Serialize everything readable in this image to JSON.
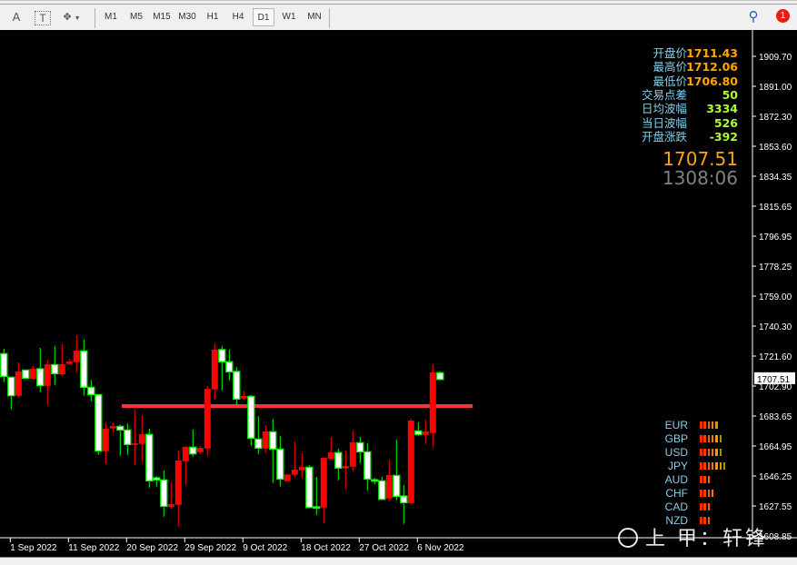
{
  "toolbar": {
    "tools": [
      {
        "name": "text-tool",
        "label": "A"
      },
      {
        "name": "text-label-tool",
        "label": "T"
      },
      {
        "name": "objects-tool",
        "label": "⬩"
      }
    ],
    "timeframes": [
      "M1",
      "M5",
      "M15",
      "M30",
      "H1",
      "H4",
      "D1",
      "W1",
      "MN"
    ],
    "active_timeframe": "D1",
    "notification_count": "1"
  },
  "info_panel": {
    "rows": [
      {
        "label": "开盘价",
        "value": "1711.43",
        "color": "#ffa500"
      },
      {
        "label": "最高价",
        "value": "1712.06",
        "color": "#ffa500"
      },
      {
        "label": "最低价",
        "value": "1706.80",
        "color": "#ffa500"
      },
      {
        "label": "交易点差",
        "value": "50",
        "color": "#adff2f"
      },
      {
        "label": "日均波幅",
        "value": "3334",
        "color": "#adff2f"
      },
      {
        "label": "当日波幅",
        "value": "526",
        "color": "#adff2f"
      },
      {
        "label": "开盘涨跌",
        "value": "-392",
        "color": "#adff2f"
      }
    ],
    "price": "1707.51",
    "countdown": "1308:06"
  },
  "price_axis": {
    "ticks": [
      "1909.70",
      "1891.00",
      "1872.30",
      "1853.60",
      "1834.35",
      "1815.65",
      "1796.95",
      "1778.25",
      "1759.00",
      "1740.30",
      "1721.60",
      "1702.90",
      "1683.65",
      "1664.95",
      "1646.25",
      "1627.55",
      "1608.85"
    ],
    "current_price_label": "1707.51"
  },
  "date_axis": [
    "1 Sep 2022",
    "11 Sep 2022",
    "20 Sep 2022",
    "29 Sep 2022",
    "9 Oct 2022",
    "18 Oct 2022",
    "27 Oct 2022",
    "6 Nov 2022"
  ],
  "currency_strength": [
    {
      "currency": "EUR",
      "level": 5
    },
    {
      "currency": "GBP",
      "level": 6
    },
    {
      "currency": "USD",
      "level": 6
    },
    {
      "currency": "JPY",
      "level": 7
    },
    {
      "currency": "AUD",
      "level": 3
    },
    {
      "currency": "CHF",
      "level": 4
    },
    {
      "currency": "CAD",
      "level": 3
    },
    {
      "currency": "NZD",
      "level": 3
    }
  ],
  "watermark": "上 甲：轩锋",
  "colors": {
    "bull_body": "#ffffff",
    "bull_border": "#00ff00",
    "bear": "#ff0000",
    "hline": "#ff3333",
    "background": "#000000"
  },
  "chart_data": {
    "type": "candlestick",
    "timeframe": "D1",
    "ylim": [
      1608.85,
      1909.7
    ],
    "horizontal_line": 1690.3,
    "ohlc": [
      [
        1708.9,
        1726.2,
        1705.3,
        1723.2
      ],
      [
        1696.8,
        1708.4,
        1688.2,
        1708.4
      ],
      [
        1712.0,
        1717.7,
        1695.6,
        1696.8
      ],
      [
        1707.8,
        1712.9,
        1707.8,
        1712.9
      ],
      [
        1713.7,
        1715.6,
        1706.8,
        1707.4
      ],
      [
        1703.2,
        1726.8,
        1699.1,
        1713.7
      ],
      [
        1716.5,
        1719.4,
        1691.1,
        1703.0
      ],
      [
        1710.6,
        1727.9,
        1703.6,
        1716.3
      ],
      [
        1716.5,
        1729.1,
        1709.3,
        1710.3
      ],
      [
        1718.2,
        1719.9,
        1716.2,
        1716.7
      ],
      [
        1725.1,
        1734.8,
        1711.6,
        1717.9
      ],
      [
        1702.1,
        1731.9,
        1696.8,
        1724.9
      ],
      [
        1697.5,
        1706.8,
        1693.3,
        1702.1
      ],
      [
        1662.2,
        1697.5,
        1659.7,
        1697.5
      ],
      [
        1676.1,
        1680.0,
        1654.0,
        1662.0
      ],
      [
        1677.8,
        1680.0,
        1673.4,
        1676.3
      ],
      [
        1675.3,
        1678.7,
        1659.2,
        1677.6
      ],
      [
        1666.2,
        1679.5,
        1659.7,
        1675.3
      ],
      [
        1666.9,
        1688.0,
        1653.5,
        1666.0
      ],
      [
        1672.6,
        1684.6,
        1655.2,
        1666.6
      ],
      [
        1643.4,
        1676.1,
        1639.2,
        1672.5
      ],
      [
        1644.0,
        1646.4,
        1639.8,
        1645.3
      ],
      [
        1627.4,
        1649.9,
        1621.0,
        1644.0
      ],
      [
        1628.8,
        1642.4,
        1625.9,
        1627.0
      ],
      [
        1656.1,
        1662.6,
        1614.7,
        1628.4
      ],
      [
        1664.7,
        1665.2,
        1640.9,
        1655.7
      ],
      [
        1660.3,
        1675.5,
        1658.6,
        1664.5
      ],
      [
        1664.1,
        1665.4,
        1660.3,
        1661.4
      ],
      [
        1701.1,
        1702.9,
        1659.2,
        1663.7
      ],
      [
        1725.7,
        1729.6,
        1694.5,
        1700.8
      ],
      [
        1718.1,
        1727.9,
        1700.2,
        1725.7
      ],
      [
        1711.8,
        1725.7,
        1706.5,
        1718.1
      ],
      [
        1694.7,
        1715.0,
        1691.1,
        1712.0
      ],
      [
        1696.6,
        1700.0,
        1694.3,
        1695.1
      ],
      [
        1670.2,
        1697.2,
        1665.4,
        1696.4
      ],
      [
        1663.9,
        1684.0,
        1660.3,
        1669.6
      ],
      [
        1674.4,
        1678.3,
        1660.7,
        1663.7
      ],
      [
        1663.3,
        1682.3,
        1642.1,
        1674.2
      ],
      [
        1644.5,
        1671.5,
        1639.8,
        1663.3
      ],
      [
        1647.4,
        1647.4,
        1643.2,
        1643.2
      ],
      [
        1650.4,
        1668.1,
        1645.9,
        1647.2
      ],
      [
        1652.1,
        1660.7,
        1645.3,
        1650.0
      ],
      [
        1626.7,
        1653.3,
        1626.1,
        1651.9
      ],
      [
        1626.7,
        1645.9,
        1622.1,
        1627.1
      ],
      [
        1657.8,
        1658.2,
        1617.0,
        1626.7
      ],
      [
        1661.2,
        1670.9,
        1656.3,
        1657.3
      ],
      [
        1651.4,
        1663.5,
        1643.8,
        1661.1
      ],
      [
        1652.7,
        1662.4,
        1638.1,
        1651.2
      ],
      [
        1667.5,
        1674.9,
        1649.5,
        1652.3
      ],
      [
        1661.6,
        1670.9,
        1654.6,
        1667.3
      ],
      [
        1644.5,
        1666.9,
        1637.5,
        1661.6
      ],
      [
        1643.8,
        1645.3,
        1641.5,
        1644.1
      ],
      [
        1631.8,
        1645.9,
        1631.2,
        1643.4
      ],
      [
        1647.0,
        1656.7,
        1630.7,
        1632.4
      ],
      [
        1633.7,
        1669.2,
        1631.2,
        1646.8
      ],
      [
        1629.7,
        1640.7,
        1616.4,
        1633.9
      ],
      [
        1681.2,
        1682.5,
        1628.9,
        1629.5
      ],
      [
        1672.5,
        1680.1,
        1671.7,
        1674.7
      ],
      [
        1674.4,
        1681.8,
        1666.6,
        1672.3
      ],
      [
        1711.4,
        1716.5,
        1664.3,
        1673.4
      ],
      [
        1707.0,
        1712.0,
        1706.4,
        1711.2
      ]
    ]
  }
}
